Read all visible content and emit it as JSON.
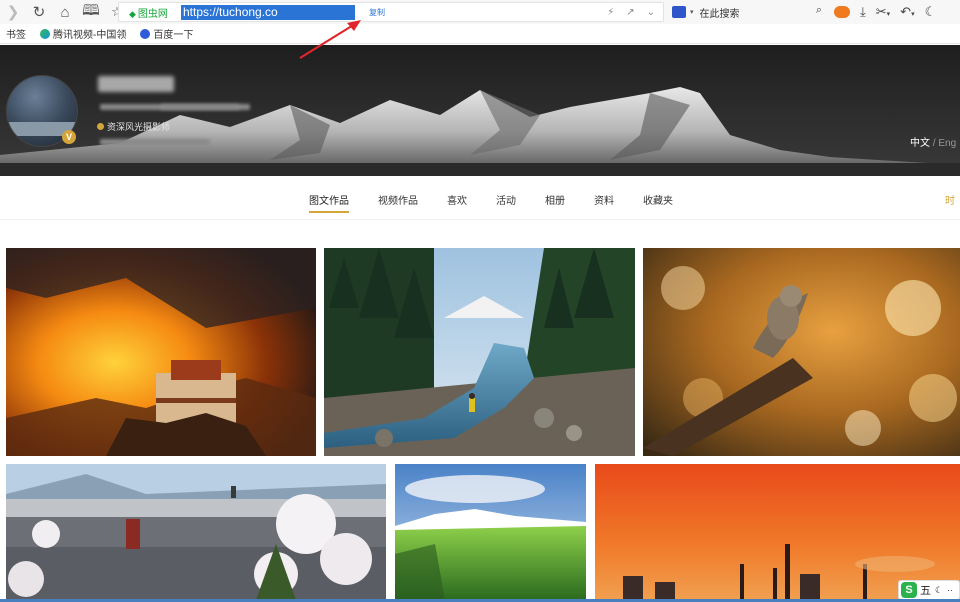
{
  "browser": {
    "site_badge": "图虫网",
    "url": "https://tuchong.co",
    "copy_label": "复制",
    "search_placeholder": "在此搜索",
    "icons": [
      "back-icon",
      "refresh-icon",
      "home-icon",
      "reader-icon",
      "star-icon",
      "bolt-icon",
      "share-icon",
      "chevron-down-icon",
      "search-icon",
      "game-icon",
      "download-icon",
      "scissors-icon",
      "undo-icon",
      "moon-icon"
    ]
  },
  "bookmarks": [
    {
      "label": "书签",
      "icon": ""
    },
    {
      "label": "腾讯视频-中国领",
      "icon": "video"
    },
    {
      "label": "百度一下",
      "icon": "baidu"
    }
  ],
  "profile": {
    "verified_badge": "V",
    "tag_label": "资深风光摄影师",
    "lang_current": "中文",
    "lang_separator": "/",
    "lang_other": "Eng"
  },
  "nav": {
    "tabs": [
      {
        "label": "图文作品",
        "active": true
      },
      {
        "label": "视频作品",
        "active": false
      },
      {
        "label": "喜欢",
        "active": false
      },
      {
        "label": "活动",
        "active": false
      },
      {
        "label": "相册",
        "active": false
      },
      {
        "label": "资料",
        "active": false
      },
      {
        "label": "收藏夹",
        "active": false
      }
    ],
    "right_label": "时"
  },
  "photos": [
    {
      "subject": "sunset-palace"
    },
    {
      "subject": "mountain-river"
    },
    {
      "subject": "squirrel-autumn"
    },
    {
      "subject": "bridge-blossoms"
    },
    {
      "subject": "snow-peak-grassland"
    },
    {
      "subject": "factory-orange-sky"
    }
  ],
  "ime": {
    "logo": "S",
    "mode": "五"
  },
  "colors": {
    "accent": "#d4a53a",
    "selection": "#2a74d6",
    "arrow": "#e0262b"
  }
}
